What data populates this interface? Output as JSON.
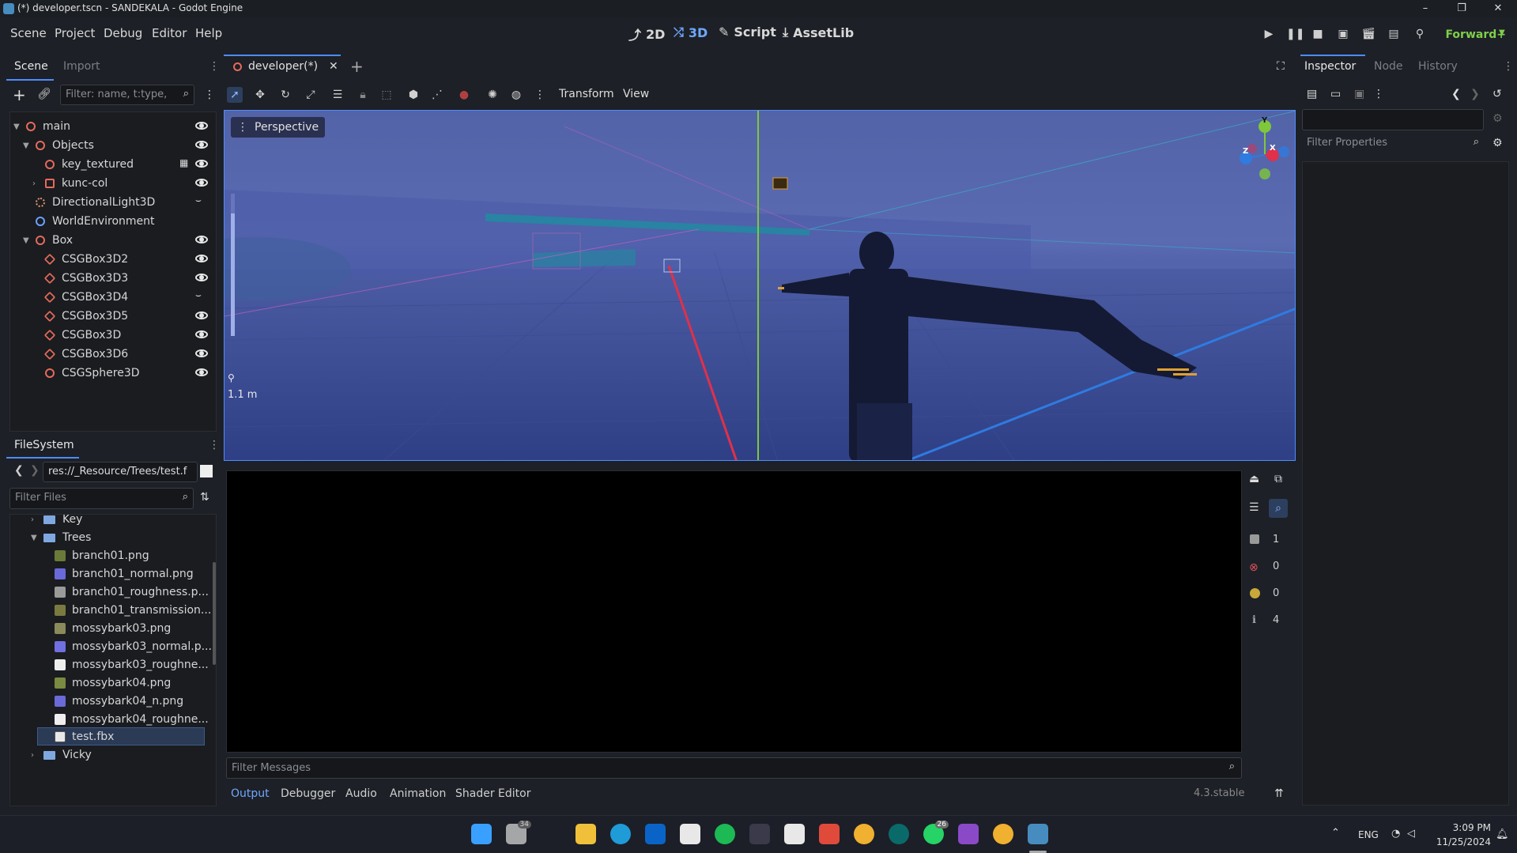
{
  "window": {
    "title": "(*) developer.tscn - SANDEKALA - Godot Engine",
    "controls": [
      "–",
      "❐",
      "✕"
    ]
  },
  "menu": {
    "items": [
      "Scene",
      "Project",
      "Debug",
      "Editor",
      "Help"
    ],
    "modes": [
      {
        "label": "2D",
        "icon": "2d-icon"
      },
      {
        "label": "3D",
        "icon": "3d-icon"
      },
      {
        "label": "Script",
        "icon": "script-icon"
      },
      {
        "label": "AssetLib",
        "icon": "assetlib-icon"
      }
    ],
    "renderer": "Forward+",
    "accent": "#6ea8ff"
  },
  "scene_dock": {
    "tabs": [
      "Scene",
      "Import"
    ],
    "filter_placeholder": "Filter: name, t:type,",
    "tree": [
      {
        "label": "main",
        "icon": "node3d-icon"
      },
      {
        "label": "Objects",
        "icon": "node3d-icon"
      },
      {
        "label": "key_textured",
        "icon": "node3d-icon"
      },
      {
        "label": "kunc-col",
        "icon": "mesh-icon"
      },
      {
        "label": "DirectionalLight3D",
        "icon": "light-icon"
      },
      {
        "label": "WorldEnvironment",
        "icon": "environment-icon"
      },
      {
        "label": "Box",
        "icon": "node3d-icon"
      },
      {
        "label": "CSGBox3D2",
        "icon": "csgbox-icon"
      },
      {
        "label": "CSGBox3D3",
        "icon": "csgbox-icon"
      },
      {
        "label": "CSGBox3D4",
        "icon": "csgbox-icon"
      },
      {
        "label": "CSGBox3D5",
        "icon": "csgbox-icon"
      },
      {
        "label": "CSGBox3D",
        "icon": "csgbox-icon"
      },
      {
        "label": "CSGBox3D6",
        "icon": "csgbox-icon"
      },
      {
        "label": "CSGSphere3D",
        "icon": "csgsphere-icon"
      }
    ]
  },
  "filesystem": {
    "tab": "FileSystem",
    "path": "res://_Resource/Trees/test.f",
    "filter_placeholder": "Filter Files",
    "items": [
      {
        "label": "Key",
        "type": "folder"
      },
      {
        "label": "Trees",
        "type": "folder"
      },
      {
        "label": "branch01.png",
        "type": "image"
      },
      {
        "label": "branch01_normal.png",
        "type": "image"
      },
      {
        "label": "branch01_roughness.p...",
        "type": "image"
      },
      {
        "label": "branch01_transmission...",
        "type": "image"
      },
      {
        "label": "mossybark03.png",
        "type": "image"
      },
      {
        "label": "mossybark03_normal.p...",
        "type": "image"
      },
      {
        "label": "mossybark03_roughne...",
        "type": "image"
      },
      {
        "label": "mossybark04.png",
        "type": "image"
      },
      {
        "label": "mossybark04_n.png",
        "type": "image"
      },
      {
        "label": "mossybark04_roughne...",
        "type": "image"
      },
      {
        "label": "test.fbx",
        "type": "scene",
        "selected": true
      },
      {
        "label": "Vicky",
        "type": "folder"
      }
    ]
  },
  "editor_tabs": {
    "active": "developer(*)",
    "add": "+"
  },
  "viewport_toolbar": {
    "transform": "Transform",
    "view": "View"
  },
  "viewport": {
    "perspective_label": "Perspective",
    "zoom_label": "1.1 m",
    "gizmo": {
      "y": "Y",
      "x": "X",
      "z": "Z"
    }
  },
  "output": {
    "filter_placeholder": "Filter Messages",
    "tabs": [
      "Output",
      "Debugger",
      "Audio",
      "Animation",
      "Shader Editor"
    ],
    "version": "4.3.stable",
    "counters": [
      {
        "icon": "message-icon",
        "value": "1"
      },
      {
        "icon": "error-icon",
        "value": "0"
      },
      {
        "icon": "warning-icon",
        "value": "0"
      },
      {
        "icon": "info-icon",
        "value": "4"
      }
    ]
  },
  "inspector": {
    "tabs": [
      "Inspector",
      "Node",
      "History"
    ],
    "filter_placeholder": "Filter Properties"
  },
  "taskbar": {
    "badges": {
      "teams": "34",
      "whatsapp": "26"
    },
    "lang": "ENG",
    "time": "3:09 PM",
    "date": "11/25/2024"
  }
}
